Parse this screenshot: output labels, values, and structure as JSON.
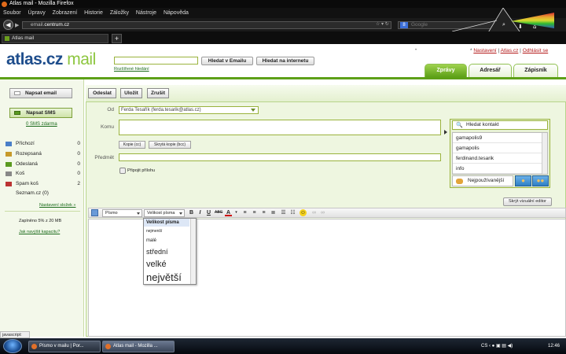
{
  "browser": {
    "window_title": "Atlas mail - Mozilla Firefox",
    "menu": [
      "Soubor",
      "Úpravy",
      "Zobrazení",
      "Historie",
      "Záložky",
      "Nástroje",
      "Nápověda"
    ],
    "url_prefix": "email.",
    "url_domain": "centrum.cz",
    "search_engine_placeholder": "Google",
    "tab_title": "Atlas mail",
    "new_tab": "+"
  },
  "header": {
    "logo_prefix": "atlas.cz",
    "logo_suffix": " mail",
    "search_email_btn": "Hledat v Emailu",
    "search_web_btn": "Hledat na internetu",
    "advanced_search": "Rozšířené hledání",
    "links": {
      "settings": "Nastavení",
      "atlas": "Atlas.cz",
      "logout": "Odhlásit se"
    },
    "separator": "|",
    "asterisk": "*",
    "dot": "•",
    "tabs": [
      "Zprávy",
      "Adresář",
      "Zápisník"
    ]
  },
  "sidebar": {
    "write_email": "Napsat email",
    "write_sms": "Napsat SMS",
    "sms_free": "0 SMS zdarma",
    "folders": [
      {
        "name": "Příchozí",
        "count": "0",
        "color": "#4a7fc8"
      },
      {
        "name": "Rozepsaná",
        "count": "0",
        "color": "#c79a2a"
      },
      {
        "name": "Odeslaná",
        "count": "0",
        "color": "#5a9a20"
      },
      {
        "name": "Koš",
        "count": "0",
        "color": "#888888"
      },
      {
        "name": "Spam koš",
        "count": "2",
        "color": "#b33"
      }
    ],
    "seznam": "Seznam.cz (0)",
    "new_folder": "Nastavení složek »",
    "quota": "Zaplněno 5% z 20 MB",
    "quota_link": "Jak navýšit kapacitu?"
  },
  "compose": {
    "send": "Odeslat",
    "save": "Uložit",
    "cancel": "Zrušit",
    "from_label": "Od",
    "from_value": "Ferda Tesařík (ferda.tesarik@atlas.cz)",
    "to_label": "Komu",
    "cc_btn": "Kopie (cc)",
    "bcc_btn": "Skrytá kopie (bcc)",
    "subject_label": "Předmět",
    "attach": "Připojit přílohu",
    "hide_editor": "Skrýt vizuální editor"
  },
  "contacts": {
    "search": "Hledat kontakt",
    "items": [
      "gamapolis9",
      "gamapolis",
      "ferdinand.tesarik",
      "info"
    ],
    "most_used": "Nejpoužívanější"
  },
  "editor_toolbar": {
    "font": "Písmo",
    "size": "Velikost písma",
    "bold": "B",
    "italic": "I",
    "underline": "U",
    "strike": "ABC",
    "color": "A"
  },
  "size_dropdown": {
    "header": "Velikost písma",
    "items": [
      "nejmenší",
      "malé",
      "střední",
      "velké",
      "největší"
    ]
  },
  "status": {
    "js": "javascript:"
  },
  "taskbar": {
    "tasks": [
      "Písmo v mailu | Por...",
      "Atlas mail - Mozilla ..."
    ],
    "lang": "CS",
    "clock": "12:46"
  }
}
